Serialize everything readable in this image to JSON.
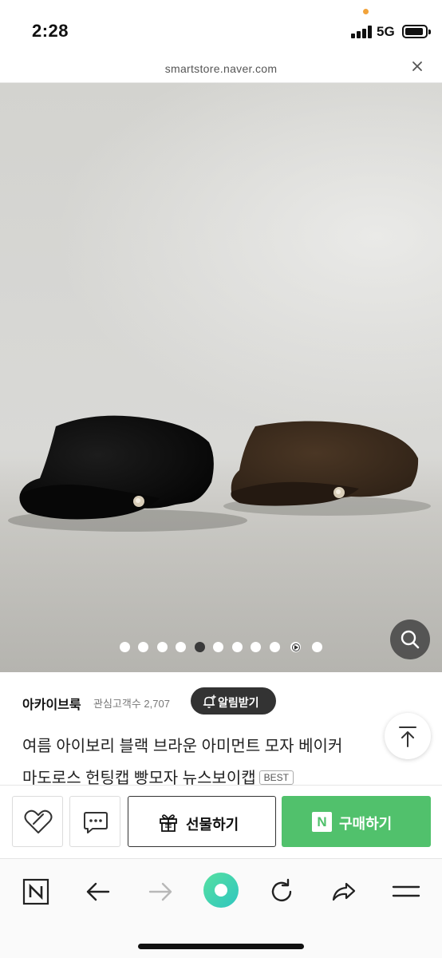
{
  "status_bar": {
    "time": "2:28",
    "network": "5G"
  },
  "browser": {
    "url": "smartstore.naver.com",
    "close_icon": "close-icon"
  },
  "gallery": {
    "image_count": 11,
    "active_index": 4,
    "play_index": 9,
    "zoom_icon": "magnifier-icon"
  },
  "store": {
    "name": "아카이브룩",
    "followers_label": "관심고객수 2,707",
    "alarm_button": "알림받기"
  },
  "product": {
    "title_line1": "여름 아이보리 블랙 브라운 아미먼트 모자 베이커",
    "title_line2": "마도로스 헌팅캡 빵모자 뉴스보이캡",
    "badge": "BEST"
  },
  "actions": {
    "gift_label": "선물하기",
    "buy_label": "구매하기",
    "buy_logo": "N"
  },
  "colors": {
    "buy_green": "#51c16c",
    "nav_accent": "#3fd1a9",
    "status_dot": "#f2a33a"
  },
  "bottom_nav": {
    "home_logo": "N"
  }
}
